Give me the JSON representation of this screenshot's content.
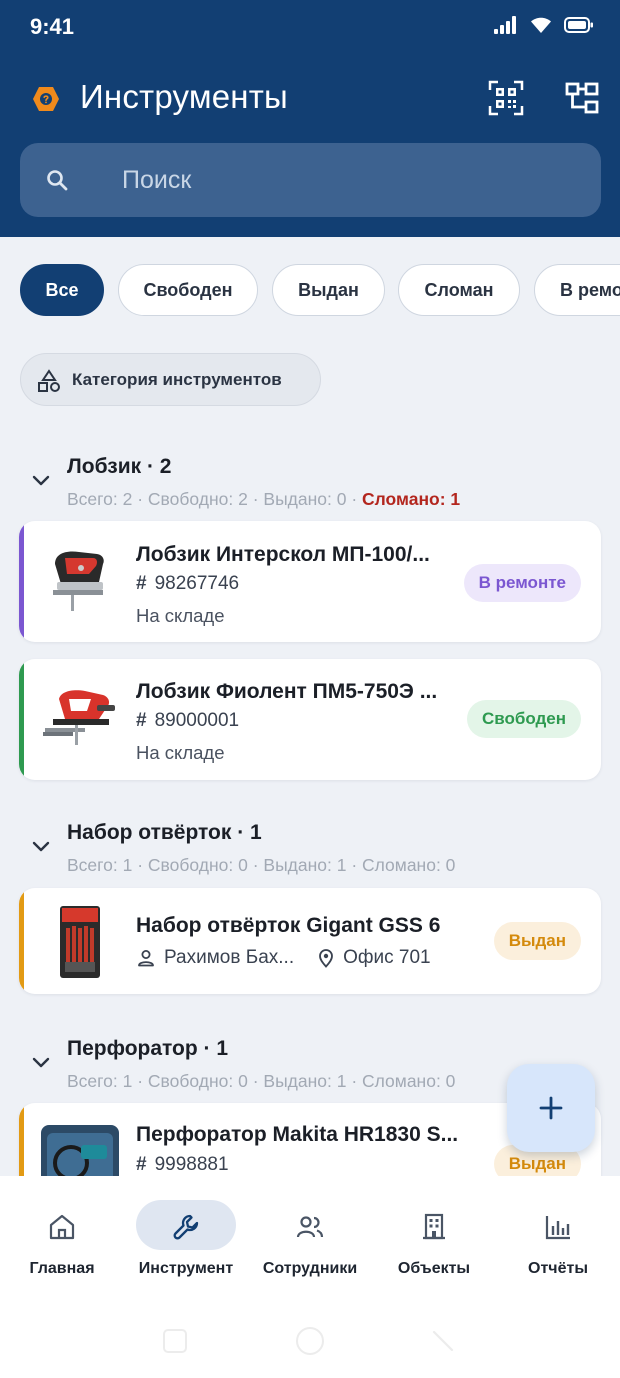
{
  "status": {
    "time": "9:41"
  },
  "header": {
    "title": "Инструменты"
  },
  "search": {
    "placeholder": "Поиск"
  },
  "filters": {
    "chips": [
      {
        "label": "Все",
        "active": true
      },
      {
        "label": "Свободен",
        "active": false
      },
      {
        "label": "Выдан",
        "active": false
      },
      {
        "label": "Сломан",
        "active": false
      },
      {
        "label": "В ремонте",
        "active": false
      }
    ],
    "category_label": "Категория инструментов"
  },
  "groups": [
    {
      "title": "Лобзик · 2",
      "stats_total": "Всего: 2",
      "stats_free": "Свободно: 2",
      "stats_issued": "Выдано: 0",
      "stats_broken": "Сломано: 1",
      "items": [
        {
          "name": "Лобзик Интерскол МП-100/...",
          "number": "98267746",
          "location": "На складе",
          "status": "В ремонте"
        },
        {
          "name": "Лобзик Фиолент ПМ5-750Э ...",
          "number": "89000001",
          "location": "На складе",
          "status": "Свободен"
        }
      ]
    },
    {
      "title": "Набор отвёрток · 1",
      "stats_total": "Всего: 1",
      "stats_free": "Свободно: 0",
      "stats_issued": "Выдано: 1",
      "stats_broken": "Сломано: 0",
      "items": [
        {
          "name": "Набор отвёрток Gigant GSS 6",
          "holder": "Рахимов Бах...",
          "place": "Офис 701",
          "status": "Выдан"
        }
      ]
    },
    {
      "title": "Перфоратор · 1",
      "stats_total": "Всего: 1",
      "stats_free": "Свободно: 0",
      "stats_issued": "Выдано: 1",
      "stats_broken": "Сломано: 0",
      "items": [
        {
          "name": "Перфоратор Makita HR1830 S...",
          "number": "9998881",
          "status": "Выдан"
        }
      ]
    }
  ],
  "fab": {
    "icon": "plus-icon"
  },
  "bottom_nav": [
    {
      "label": "Главная",
      "icon": "home-icon",
      "active": false
    },
    {
      "label": "Инструмент",
      "icon": "wrench-icon",
      "active": true
    },
    {
      "label": "Сотрудники",
      "icon": "people-icon",
      "active": false
    },
    {
      "label": "Объекты",
      "icon": "building-icon",
      "active": false
    },
    {
      "label": "Отчёты",
      "icon": "bar-chart-icon",
      "active": false
    }
  ],
  "colors": {
    "header": "#123f73",
    "accent_repair": "#7b57d1",
    "accent_free": "#2e9a50",
    "accent_issued": "#e29a14",
    "broken_text": "#b3261e"
  }
}
